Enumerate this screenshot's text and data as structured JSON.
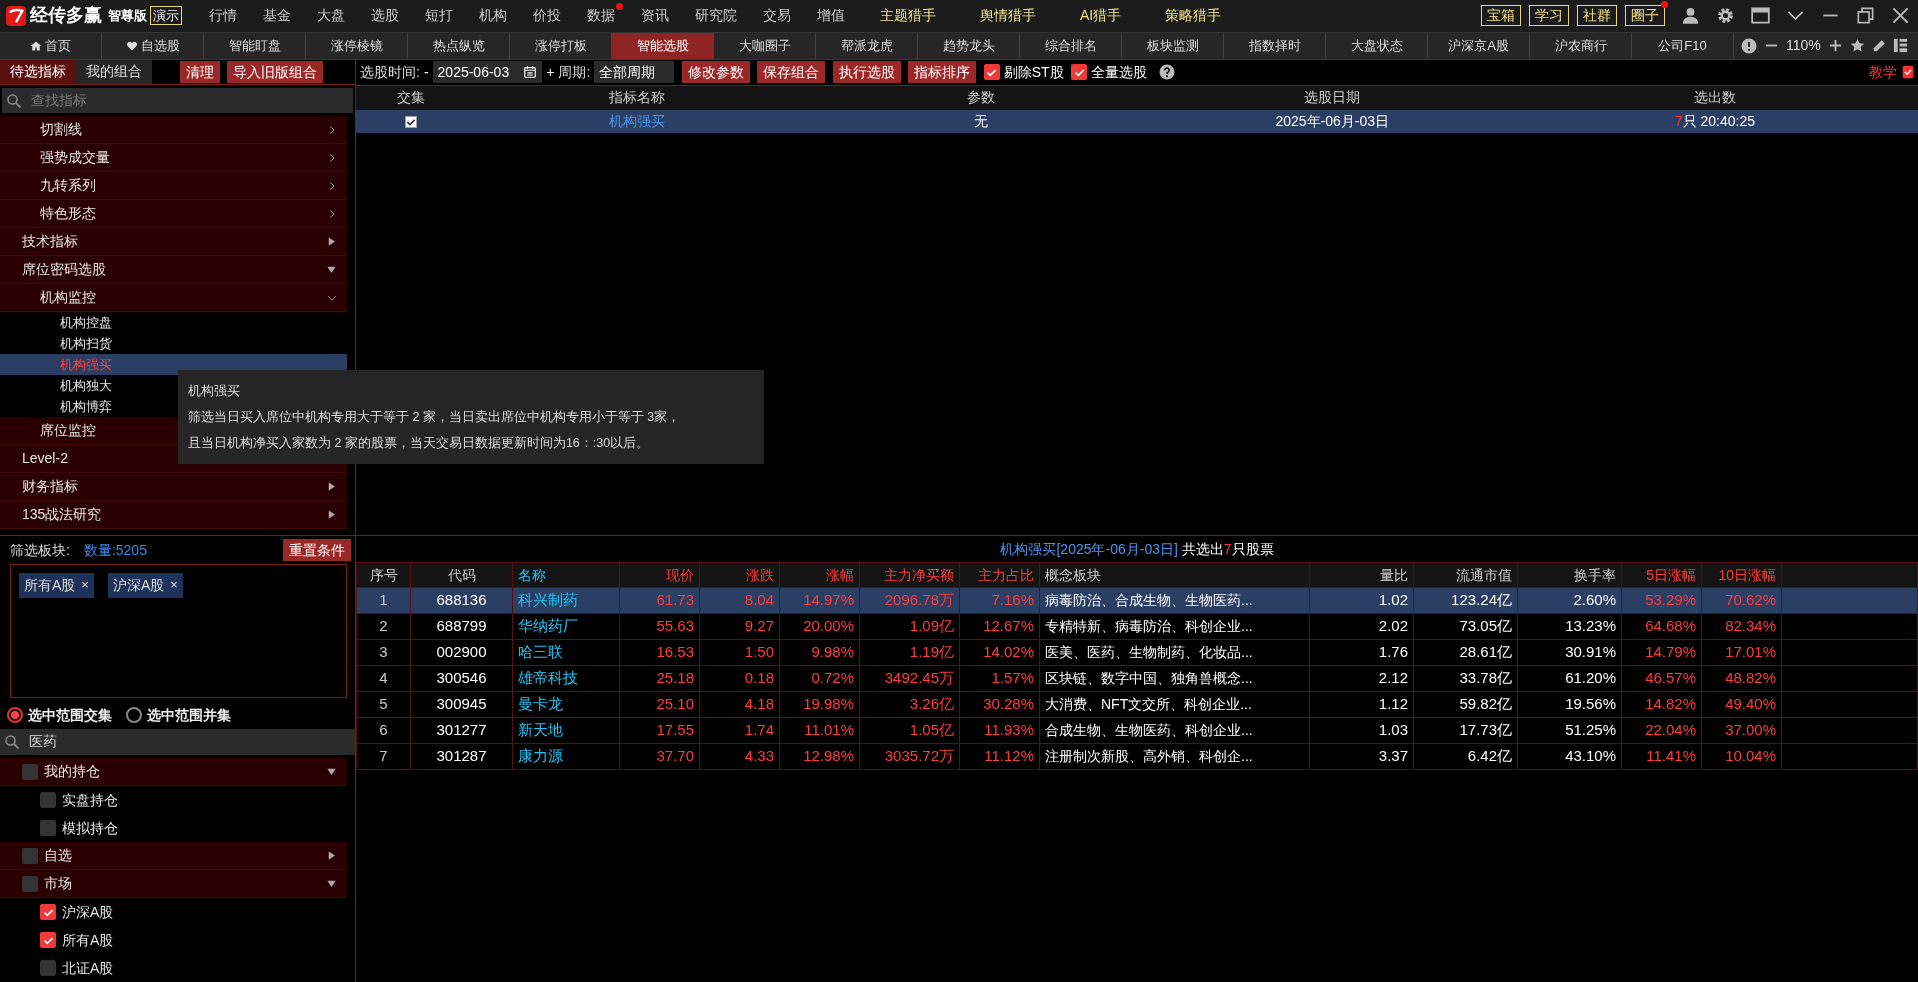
{
  "app": {
    "brand": "经传多赢",
    "edition": "智尊版",
    "demo": "演示"
  },
  "menu": [
    {
      "label": "行情",
      "kind": "plain",
      "badge": false
    },
    {
      "label": "基金",
      "kind": "plain",
      "badge": false
    },
    {
      "label": "大盘",
      "kind": "plain",
      "badge": false
    },
    {
      "label": "选股",
      "kind": "plain",
      "badge": false
    },
    {
      "label": "短打",
      "kind": "plain",
      "badge": false
    },
    {
      "label": "机构",
      "kind": "plain",
      "badge": false
    },
    {
      "label": "价投",
      "kind": "plain",
      "badge": false
    },
    {
      "label": "数据",
      "kind": "plain",
      "badge": true
    },
    {
      "label": "资讯",
      "kind": "plain",
      "badge": false
    },
    {
      "label": "研究院",
      "kind": "plain",
      "badge": false
    },
    {
      "label": "交易",
      "kind": "plain",
      "badge": false
    },
    {
      "label": "增值",
      "kind": "plain",
      "badge": false
    },
    {
      "label": "主题猎手",
      "kind": "hunter",
      "badge": false
    },
    {
      "label": "舆情猎手",
      "kind": "hunter",
      "badge": false
    },
    {
      "label": "AI猎手",
      "kind": "hunter",
      "badge": false
    },
    {
      "label": "策略猎手",
      "kind": "hunter",
      "badge": false
    }
  ],
  "header_buttons": [
    {
      "label": "宝箱",
      "badge": false
    },
    {
      "label": "学习",
      "badge": false
    },
    {
      "label": "社群",
      "badge": false
    },
    {
      "label": "圈子",
      "badge": true
    }
  ],
  "tabs": [
    {
      "label": "首页",
      "kind": "home",
      "selected": false
    },
    {
      "label": "自选股",
      "kind": "heart",
      "selected": false
    },
    {
      "label": "智能盯盘",
      "kind": "plain",
      "selected": false
    },
    {
      "label": "涨停棱镜",
      "kind": "plain",
      "selected": false
    },
    {
      "label": "热点纵览",
      "kind": "plain",
      "selected": false
    },
    {
      "label": "涨停打板",
      "kind": "plain",
      "selected": false
    },
    {
      "label": "智能选股",
      "kind": "plain",
      "selected": true
    },
    {
      "label": "大咖圈子",
      "kind": "plain",
      "selected": false
    },
    {
      "label": "帮派龙虎",
      "kind": "plain",
      "selected": false
    },
    {
      "label": "趋势龙头",
      "kind": "plain",
      "selected": false
    },
    {
      "label": "综合排名",
      "kind": "plain",
      "selected": false
    },
    {
      "label": "板块监测",
      "kind": "plain",
      "selected": false
    },
    {
      "label": "指数择时",
      "kind": "plain",
      "selected": false
    },
    {
      "label": "大盘状态",
      "kind": "plain",
      "selected": false
    },
    {
      "label": "沪深京A股",
      "kind": "plain",
      "selected": false
    },
    {
      "label": "沪农商行",
      "kind": "plain",
      "selected": false
    },
    {
      "label": "公司F10",
      "kind": "plain",
      "selected": false
    }
  ],
  "zoom": "110%",
  "left_tabs": [
    {
      "label": "待选指标",
      "selected": true
    },
    {
      "label": "我的组合",
      "selected": false
    }
  ],
  "left_buttons": [
    "清理",
    "导入旧版组合"
  ],
  "indicator_search": {
    "placeholder": "查找指标"
  },
  "tree": [
    {
      "children": [
        {
          "label": "切割线",
          "expanded": false
        },
        {
          "label": "强势成交量",
          "expanded": false
        },
        {
          "label": "九转系列",
          "expanded": false
        },
        {
          "label": "特色形态",
          "expanded": false
        }
      ]
    },
    {
      "label": "技术指标",
      "expanded": false
    },
    {
      "label": "席位密码选股",
      "expanded": true,
      "children": [
        {
          "label": "机构监控",
          "expanded": true,
          "children": [
            {
              "label": "机构控盘",
              "selected": false
            },
            {
              "label": "机构扫货",
              "selected": false
            },
            {
              "label": "机构强买",
              "selected": true
            },
            {
              "label": "机构独大",
              "selected": false
            },
            {
              "label": "机构博弈",
              "selected": false
            }
          ]
        },
        {
          "label": "席位监控",
          "expanded": false
        }
      ]
    },
    {
      "label": "Level-2",
      "expanded": false
    },
    {
      "label": "财务指标",
      "expanded": false
    },
    {
      "label": "135战法研究",
      "expanded": false
    }
  ],
  "tooltip": {
    "title": "机构强买",
    "lines": [
      "筛选当日买入席位中机构专用大于等于 2 家，当日卖出席位中机构专用小于等于 3家，",
      "且当日机构净买入家数为 2 家的股票，当天交易日数据更新时间为16：:30以后。"
    ]
  },
  "filter": {
    "label": "筛选板块:",
    "count": "数量:5205",
    "reset": "重置条件",
    "tags": [
      {
        "label": "所有A股",
        "remove": "×"
      },
      {
        "label": "沪深A股",
        "remove": "×"
      }
    ]
  },
  "range_options": [
    {
      "label": "选中范围交集",
      "selected": true
    },
    {
      "label": "选中范围并集",
      "selected": false
    }
  ],
  "sector_search": {
    "value": "医药"
  },
  "sector_tree": [
    {
      "label": "我的持仓",
      "checked": false,
      "expanded": true,
      "children": [
        {
          "label": "实盘持仓",
          "checked": false
        },
        {
          "label": "模拟持仓",
          "checked": false
        }
      ]
    },
    {
      "label": "自选",
      "checked": false,
      "expanded": false
    },
    {
      "label": "市场",
      "checked": false,
      "expanded": true,
      "children": [
        {
          "label": "沪深A股",
          "checked": true
        },
        {
          "label": "所有A股",
          "checked": true
        },
        {
          "label": "北证A股",
          "checked": false
        }
      ]
    }
  ],
  "toolbar": {
    "time_label": "选股时间:",
    "minus": "-",
    "date": "2025-06-03",
    "plus": "+",
    "period_label": "周期:",
    "period": "全部周期",
    "buttons": [
      "修改参数",
      "保存组合",
      "执行选股",
      "指标排序"
    ],
    "checks": [
      {
        "label": "剔除ST股",
        "checked": true
      },
      {
        "label": "全量选股",
        "checked": true
      }
    ],
    "teach": "教学"
  },
  "indicator_table": {
    "columns": [
      "交集",
      "指标名称",
      "参数",
      "选股日期",
      "选出数"
    ],
    "rows": [
      {
        "selected": true,
        "checked": true,
        "name": "机构强买",
        "param": "无",
        "date": "2025年-06月-03日",
        "count": "7",
        "unit": "只",
        "time": "20:40:25"
      }
    ]
  },
  "result": {
    "title": "机构强买[2025年-06月-03日]",
    "prefix": "共选出",
    "count": "7",
    "suffix": "只股票",
    "columns": [
      {
        "label": "序号",
        "kind": "index"
      },
      {
        "label": "代码",
        "kind": "code"
      },
      {
        "label": "名称",
        "kind": "name"
      },
      {
        "label": "现价",
        "kind": "up"
      },
      {
        "label": "涨跌",
        "kind": "up"
      },
      {
        "label": "涨幅",
        "kind": "up"
      },
      {
        "label": "主力净买额",
        "kind": "up"
      },
      {
        "label": "主力占比",
        "kind": "up"
      },
      {
        "label": "概念板块",
        "kind": "concept"
      },
      {
        "label": "量比",
        "kind": "plain"
      },
      {
        "label": "流通市值",
        "kind": "plain"
      },
      {
        "label": "换手率",
        "kind": "plain"
      },
      {
        "label": "5日涨幅",
        "kind": "up"
      },
      {
        "label": "10日涨幅",
        "kind": "up"
      }
    ],
    "rows": [
      {
        "selected": true,
        "cells": [
          "1",
          "688136",
          "科兴制药",
          "61.73",
          "8.04",
          "14.97%",
          "2096.78万",
          "7.16%",
          "病毒防治、合成生物、生物医药...",
          "1.02",
          "123.24亿",
          "2.60%",
          "53.29%",
          "70.62%"
        ]
      },
      {
        "selected": false,
        "cells": [
          "2",
          "688799",
          "华纳药厂",
          "55.63",
          "9.27",
          "20.00%",
          "1.09亿",
          "12.67%",
          "专精特新、病毒防治、科创企业...",
          "2.02",
          "73.05亿",
          "13.23%",
          "64.68%",
          "82.34%"
        ]
      },
      {
        "selected": false,
        "cells": [
          "3",
          "002900",
          "哈三联",
          "16.53",
          "1.50",
          "9.98%",
          "1.19亿",
          "14.02%",
          "医美、医药、生物制药、化妆品...",
          "1.76",
          "28.61亿",
          "30.91%",
          "14.79%",
          "17.01%"
        ]
      },
      {
        "selected": false,
        "cells": [
          "4",
          "300546",
          "雄帝科技",
          "25.18",
          "0.18",
          "0.72%",
          "3492.45万",
          "1.57%",
          "区块链、数字中国、独角兽概念...",
          "2.12",
          "33.78亿",
          "61.20%",
          "46.57%",
          "48.82%"
        ]
      },
      {
        "selected": false,
        "cells": [
          "5",
          "300945",
          "曼卡龙",
          "25.10",
          "4.18",
          "19.98%",
          "3.26亿",
          "30.28%",
          "大消费、NFT文交所、科创企业...",
          "1.12",
          "59.82亿",
          "19.56%",
          "14.82%",
          "49.40%"
        ]
      },
      {
        "selected": false,
        "cells": [
          "6",
          "301277",
          "新天地",
          "17.55",
          "1.74",
          "11.01%",
          "1.05亿",
          "11.93%",
          "合成生物、生物医药、科创企业...",
          "1.03",
          "17.73亿",
          "51.25%",
          "22.04%",
          "37.00%"
        ]
      },
      {
        "selected": false,
        "cells": [
          "7",
          "301287",
          "康力源",
          "37.70",
          "4.33",
          "12.98%",
          "3035.72万",
          "11.12%",
          "注册制次新股、高外销、科创企...",
          "3.37",
          "6.42亿",
          "43.10%",
          "11.41%",
          "10.04%"
        ]
      }
    ]
  }
}
